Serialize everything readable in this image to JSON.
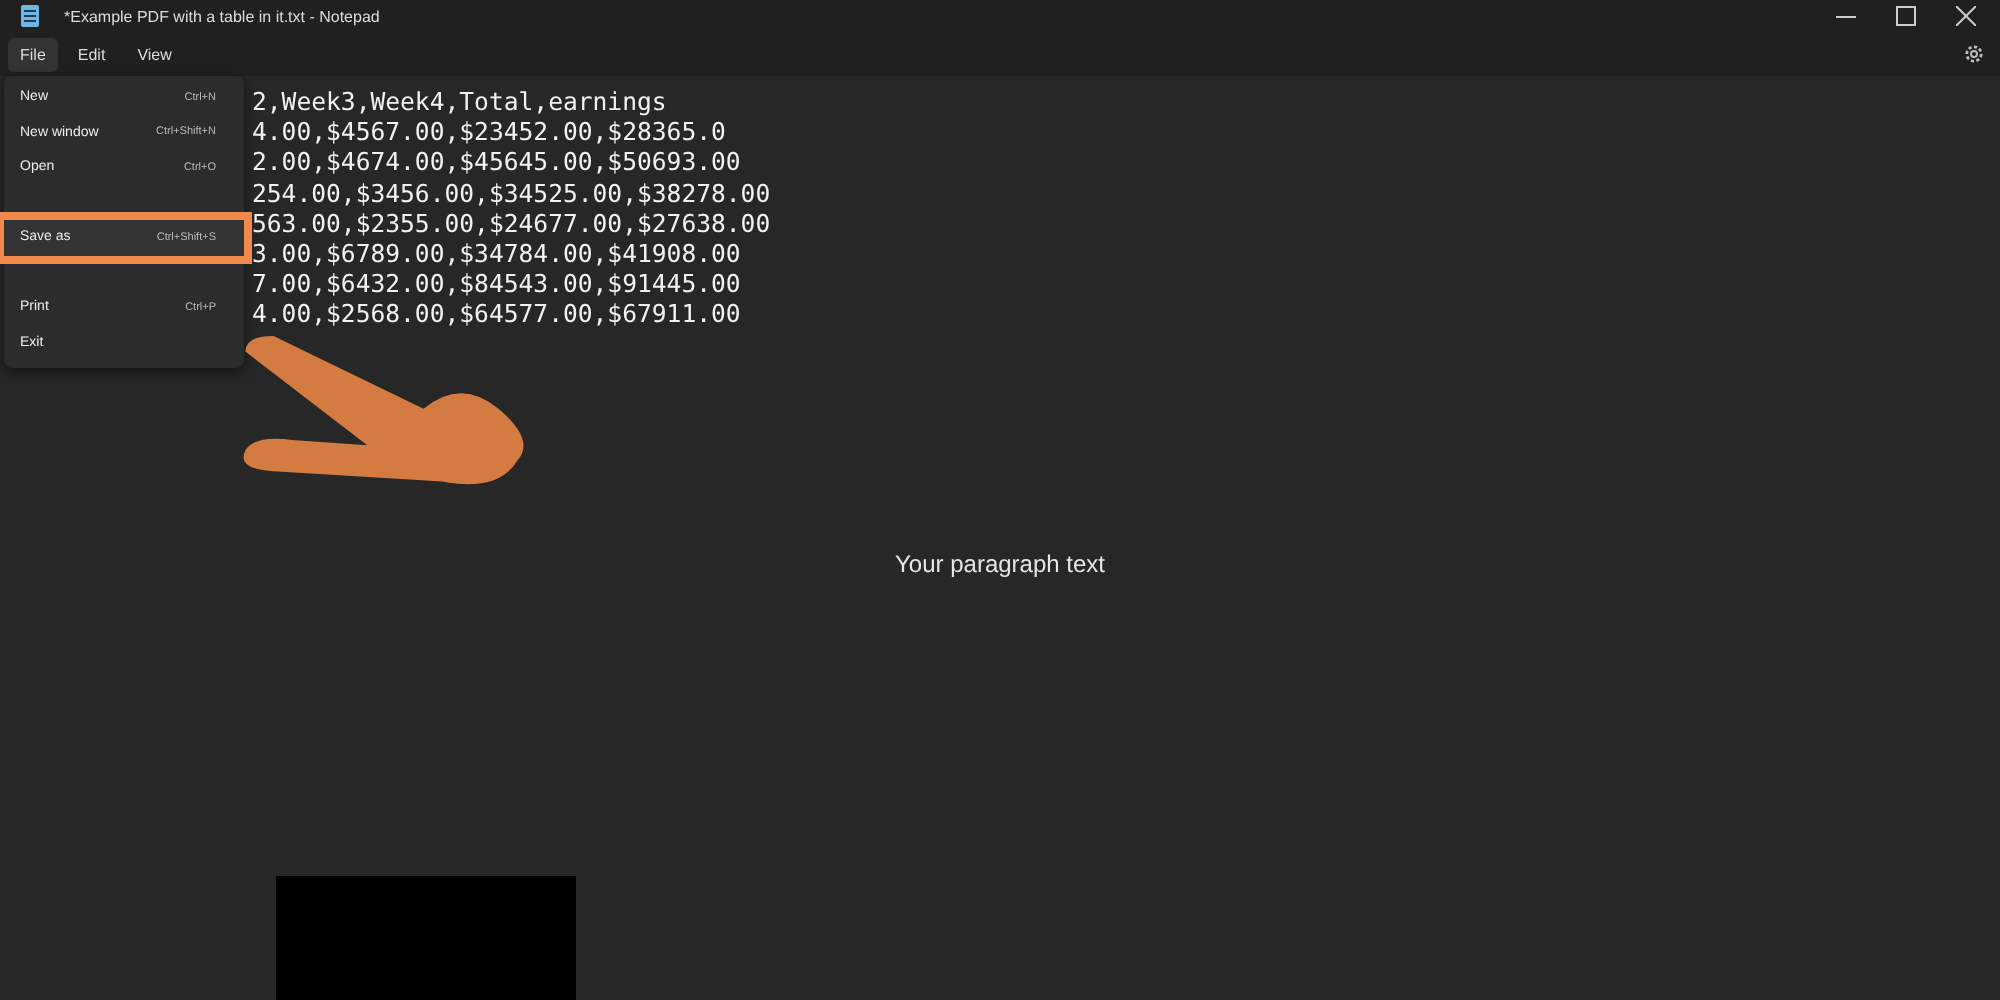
{
  "window": {
    "title": "*Example PDF with a table in it.txt - Notepad"
  },
  "menu_bar": [
    {
      "label": "File",
      "selected": true
    },
    {
      "label": "Edit",
      "selected": false
    },
    {
      "label": "View",
      "selected": false
    }
  ],
  "file_menu": [
    {
      "label": "New",
      "shortcut": "Ctrl+N",
      "kind": "item"
    },
    {
      "label": "New window",
      "shortcut": "Ctrl+Shift+N",
      "kind": "item"
    },
    {
      "label": "Open",
      "shortcut": "Ctrl+O",
      "kind": "item"
    },
    {
      "kind": "hidden"
    },
    {
      "label": "Save as",
      "shortcut": "Ctrl+Shift+S",
      "kind": "highlighted"
    },
    {
      "kind": "hidden"
    },
    {
      "label": "Print",
      "shortcut": "Ctrl+P",
      "kind": "item"
    },
    {
      "label": "Exit",
      "kind": "item"
    }
  ],
  "editor": {
    "lines": [
      "2,Week3,Week4,Total,earnings",
      "4.00,$4567.00,$23452.00,$28365.0",
      "2.00,$4674.00,$45645.00,$50693.00",
      "254.00,$3456.00,$34525.00,$38278.00",
      "563.00,$2355.00,$24677.00,$27638.00",
      "3.00,$6789.00,$34784.00,$41908.00",
      "7.00,$6432.00,$84543.00,$91445.00",
      "4.00,$2568.00,$64577.00,$67911.00"
    ],
    "overlay_text": "Your paragraph text"
  }
}
